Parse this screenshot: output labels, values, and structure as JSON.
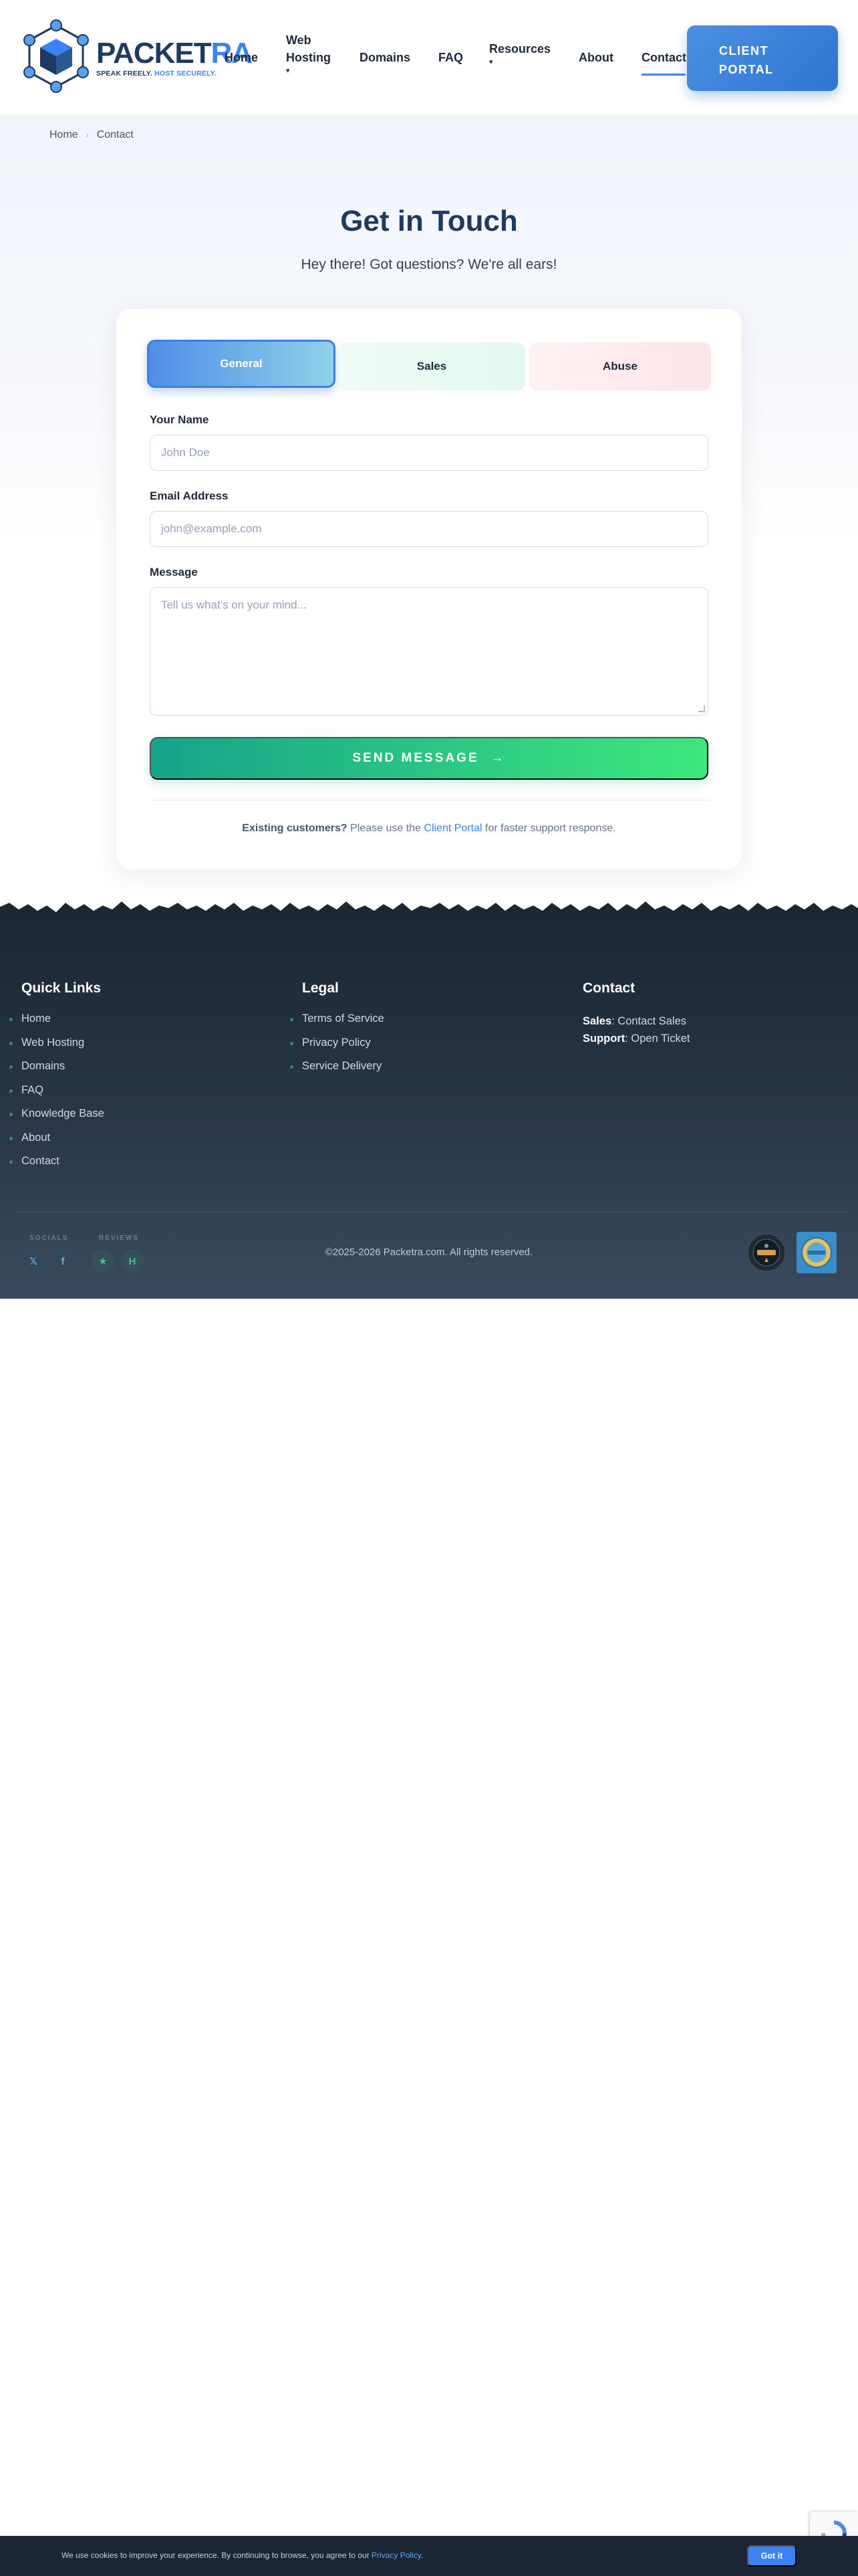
{
  "brand": {
    "name_a": "PACKET",
    "name_b": "RA",
    "tagline_a": "SPEAK FREELY. ",
    "tagline_b": "HOST SECURELY."
  },
  "nav": {
    "home": "Home",
    "web_hosting_a": "Web",
    "web_hosting_b": "Hosting",
    "domains": "Domains",
    "faq": "FAQ",
    "resources": "Resources",
    "about": "About",
    "contact": "Contact",
    "caret": "▾",
    "cta_a": "CLIENT",
    "cta_b": "PORTAL"
  },
  "breadcrumb": {
    "home": "Home",
    "sep": "›",
    "current": "Contact"
  },
  "hero": {
    "title": "Get in Touch",
    "subtitle": "Hey there! Got questions? We're all ears!"
  },
  "form": {
    "tabs": [
      {
        "label": "General"
      },
      {
        "label": "Sales"
      },
      {
        "label": "Abuse"
      }
    ],
    "name_label": "Your Name",
    "name_placeholder": "John Doe",
    "email_label": "Email Address",
    "email_placeholder": "john@example.com",
    "message_label": "Message",
    "message_placeholder": "Tell us what's on your mind...",
    "send_label": "SEND MESSAGE",
    "send_arrow": "→",
    "note_bold": "Existing customers?",
    "note_pre": " Please use the ",
    "note_link": "Client Portal",
    "note_post": " for faster support response."
  },
  "footer": {
    "quick_links_title": "Quick Links",
    "quick_links": [
      "Home",
      "Web Hosting",
      "Domains",
      "FAQ",
      "Knowledge Base",
      "About",
      "Contact"
    ],
    "legal_title": "Legal",
    "legal_links": [
      "Terms of Service",
      "Privacy Policy",
      "Service Delivery"
    ],
    "contact_title": "Contact",
    "sales_label": "Sales",
    "sales_value": ": Contact Sales",
    "support_label": "Support",
    "support_value": ": Open Ticket",
    "socials_label": "SOCIALS",
    "reviews_label": "REVIEWS",
    "x_glyph": "𝕏",
    "fb_glyph": "f",
    "star_glyph": "★",
    "h_glyph": "H",
    "copyright": "©2025-2026 Packetra.com. All rights reserved."
  },
  "cookie": {
    "text": "We use cookies to improve your experience. By continuing to browse, you agree to our ",
    "link": "Privacy Policy",
    "end": ".",
    "button": "Got it"
  },
  "colors": {
    "accent": "#3b82f6",
    "navy": "#1e3a5f",
    "send_start": "#16a38a",
    "send_end": "#3ee87d"
  }
}
